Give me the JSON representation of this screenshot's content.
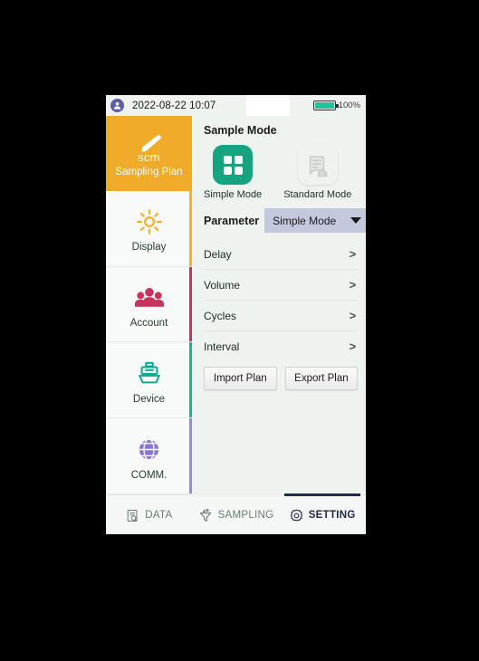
{
  "statusbar": {
    "avatar_icon": "user-avatar-icon",
    "datetime": "2022-08-22 10:07",
    "battery_icon": "battery-icon",
    "battery_percent": "100%"
  },
  "sidebar": {
    "items": [
      {
        "label": "Sampling Plan",
        "icon": "pen-scm-icon",
        "sub": "scm",
        "accent": "#f0ab29",
        "active": true
      },
      {
        "label": "Display",
        "icon": "brightness-sun-icon",
        "accent": "#f3b22b",
        "active": false
      },
      {
        "label": "Account",
        "icon": "people-group-icon",
        "accent": "#c8335c",
        "active": false
      },
      {
        "label": "Device",
        "icon": "device-sampler-icon",
        "accent": "#14b898",
        "active": false
      },
      {
        "label": "COMM.",
        "icon": "globe-network-icon",
        "accent": "#9b87de",
        "active": false
      }
    ]
  },
  "main": {
    "section_title": "Sample Mode",
    "modes": [
      {
        "label": "Simple Mode",
        "icon": "grid-four-squares-icon",
        "selected": true
      },
      {
        "label": "Standard Mode",
        "icon": "document-home-icon",
        "selected": false
      }
    ],
    "parameter": {
      "label": "Parameter",
      "value": "Simple Mode",
      "caret_icon": "chevron-down-icon"
    },
    "list": [
      {
        "label": "Delay",
        "chevron": ">"
      },
      {
        "label": "Volume",
        "chevron": ">"
      },
      {
        "label": "Cycles",
        "chevron": ">"
      },
      {
        "label": "Interval",
        "chevron": ">"
      }
    ],
    "buttons": [
      {
        "label": "Import Plan"
      },
      {
        "label": "Export Plan"
      }
    ]
  },
  "bottomnav": {
    "items": [
      {
        "label": "DATA",
        "icon": "data-search-icon",
        "active": false
      },
      {
        "label": "SAMPLING",
        "icon": "funnel-sampling-icon",
        "active": false
      },
      {
        "label": "SETTING",
        "icon": "gear-icon",
        "active": true
      }
    ]
  },
  "colors": {
    "brand_orange": "#f0ab29",
    "accent_green": "#16a37f",
    "select_bg": "#c3c8dc",
    "active_nav": "#1f2a4d"
  }
}
